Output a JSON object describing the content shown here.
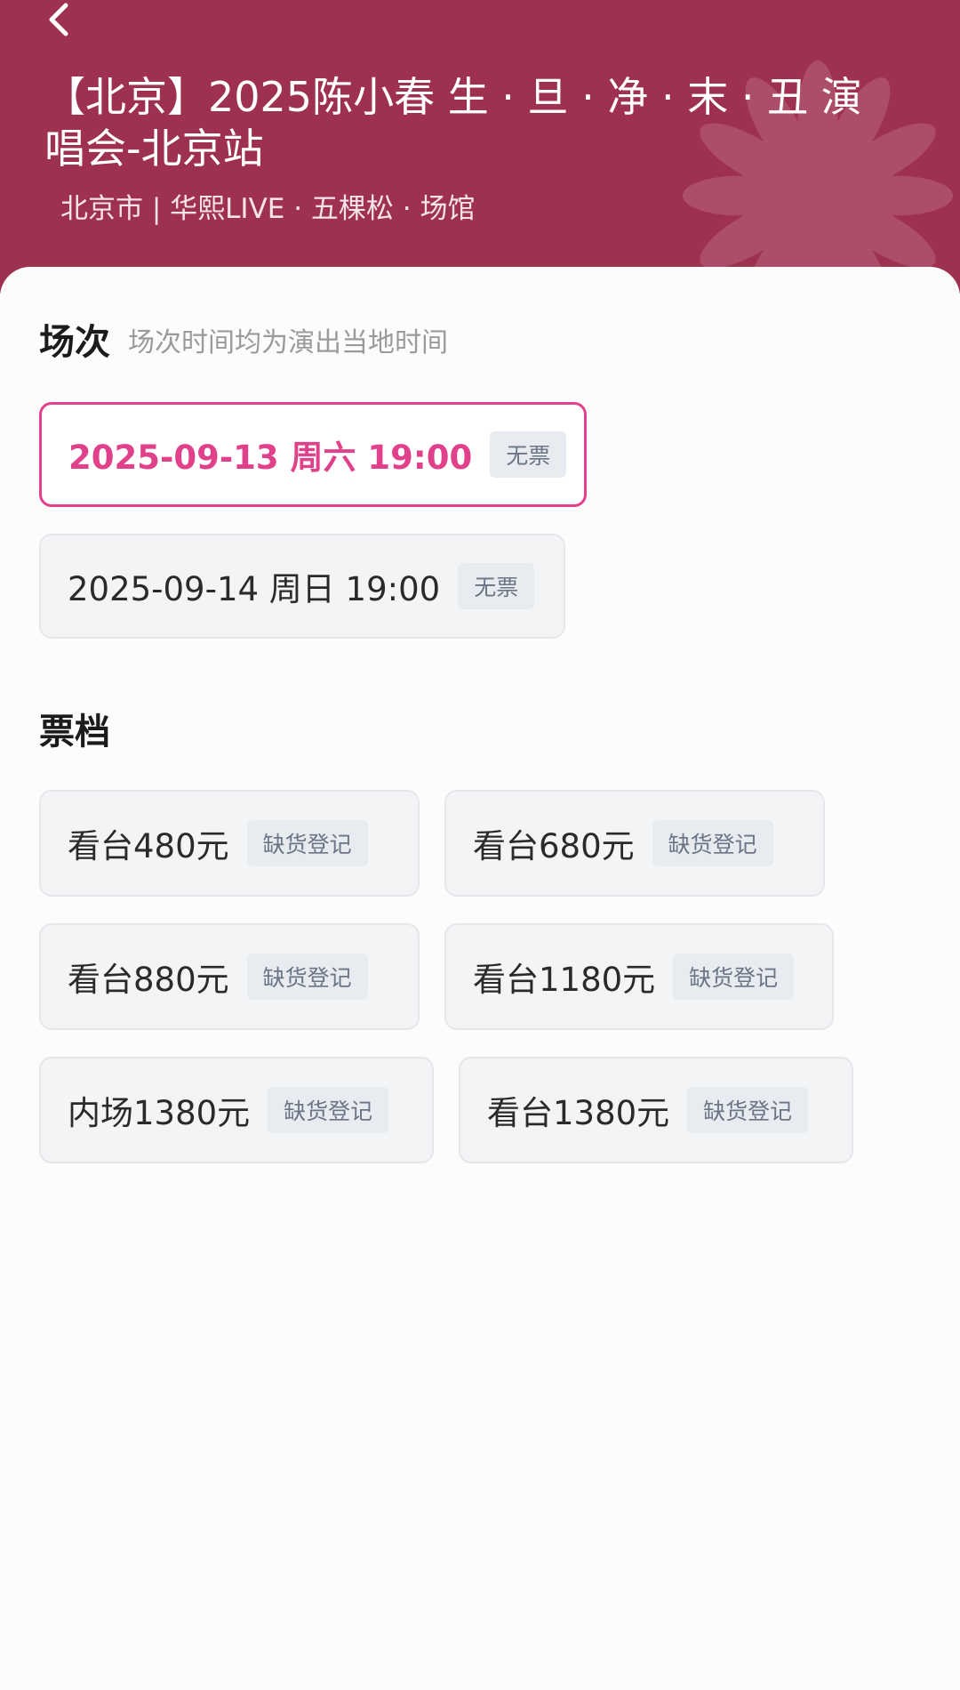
{
  "header": {
    "title": "【北京】2025陈小春 生 · 旦 · 净 · 末 · 丑 演唱会-北京站",
    "venue": "北京市 | 华熙LIVE · 五棵松 · 场馆",
    "bg_color": "#9e3150"
  },
  "sessions": {
    "heading": "场次",
    "note": "场次时间均为演出当地时间",
    "items": [
      {
        "label": "2025-09-13  周六 19:00",
        "badge": "无票",
        "selected": true
      },
      {
        "label": "2025-09-14 周日 19:00",
        "badge": "无票",
        "selected": false
      }
    ]
  },
  "tiers": {
    "heading": "票档",
    "items": [
      {
        "label": "看台480元",
        "badge": "缺货登记"
      },
      {
        "label": "看台680元",
        "badge": "缺货登记"
      },
      {
        "label": "看台880元",
        "badge": "缺货登记"
      },
      {
        "label": "看台1180元",
        "badge": "缺货登记"
      },
      {
        "label": "内场1380元",
        "badge": "缺货登记"
      },
      {
        "label": "看台1380元",
        "badge": "缺货登记"
      }
    ]
  },
  "colors": {
    "accent": "#e0418a",
    "badge_bg": "#e8ecf1",
    "badge_text": "#6b7585"
  },
  "icons": {
    "back": "chevron-left-icon",
    "decoration": "flower-icon"
  }
}
